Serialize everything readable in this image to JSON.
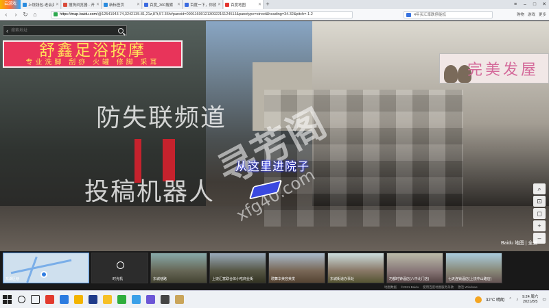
{
  "browser": {
    "logo_text": "云游戏",
    "tabs": [
      {
        "title": "上饶钱包-老会买网投网投专业",
        "color": "#2a8bde",
        "active": false
      },
      {
        "title": "搜狗浏览器 - 开启网络安全新时代",
        "color": "#d94b3b",
        "active": false
      },
      {
        "title": "新标签页",
        "color": "#2a8bde",
        "active": false
      },
      {
        "title": "百度_360搜索",
        "color": "#3b6be0",
        "active": false
      },
      {
        "title": "百度一下，你就知道",
        "color": "#3b6be0",
        "active": false
      },
      {
        "title": "百度地图",
        "color": "#e3342f",
        "active": true
      }
    ],
    "newtab": "+",
    "win_controls": [
      "≡",
      "–",
      "□",
      "✕"
    ]
  },
  "address": {
    "back": "‹",
    "forward": "›",
    "refresh": "↻",
    "home": "⌂",
    "host": "https://map.baidu.com",
    "path": "/@12541943.74,3242135.81,21z,87t,57.36h#panoid=09011600121309221612451J&panotype=street&heading=34.32&pitch=-1.2",
    "search_hint": "4年买汇率跌停能抵",
    "right_items": [
      "购物",
      "游戏",
      "更多"
    ]
  },
  "panorama": {
    "search_placeholder": "搜索地址",
    "sign_left_big": "舒鑫足浴按摩",
    "sign_left_small": "专业洗脚  刮痧  火罐  修脚  采耳",
    "sign_right_text": "完美发屋",
    "watermark_line1": "防失联频道",
    "watermark_line2": "投稿机器人",
    "watermark_diag": "寻芳阁",
    "watermark_url": "xfg40.com",
    "nav_label": "从这里进院子",
    "brand": "Baidu 地图 | 全景"
  },
  "tools": [
    "⌕",
    "⊡",
    "◻",
    "+",
    "–"
  ],
  "filmstrip": [
    {
      "caption": "东湖区巷",
      "kind": "map"
    },
    {
      "caption": "时光机",
      "kind": "history"
    },
    {
      "caption": "东城巷路",
      "kind": "photo"
    },
    {
      "caption": "上饶汇富联合体小吃商业街",
      "kind": "photo"
    },
    {
      "caption": "瓒舞华美容美发",
      "kind": "photo"
    },
    {
      "caption": "东城街道办事处",
      "kind": "photo"
    },
    {
      "caption": "巧都时钟酒店(八中北门店)",
      "kind": "photo"
    },
    {
      "caption": "七天连锁酒店(上饶中山路店)",
      "kind": "photo"
    }
  ],
  "bottom_info": [
    "地图数据",
    "©2021 Baidu",
    "使用百度地图服务条款",
    "激活 Windows"
  ],
  "taskbar": {
    "weather": "32°C  晴朗",
    "time": "9:24 周六",
    "date": "2021/8/5"
  }
}
